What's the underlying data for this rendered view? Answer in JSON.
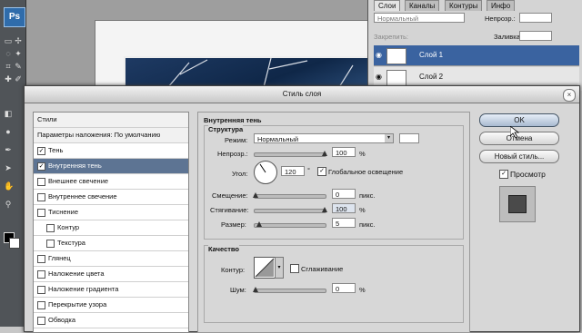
{
  "background": {
    "panel_tabs": [
      "Слои",
      "Каналы",
      "Контуры",
      "Инфо"
    ],
    "blend_mode": "Нормальный",
    "opacity_label": "Непрозр.:",
    "lock_label": "Закрепить:",
    "fill_label": "Заливка:",
    "layers": [
      {
        "name": "Слой 1"
      },
      {
        "name": "Слой 2"
      }
    ]
  },
  "dialog": {
    "title": "Стиль слоя",
    "styles_list": [
      {
        "label": "Стили",
        "checkbox": false,
        "checked": false,
        "header": true
      },
      {
        "label": "Параметры наложения: По умолчанию",
        "checkbox": false,
        "checked": false,
        "header": true
      },
      {
        "label": "Тень",
        "checkbox": true,
        "checked": true
      },
      {
        "label": "Внутренняя тень",
        "checkbox": true,
        "checked": true,
        "selected": true
      },
      {
        "label": "Внешнее свечение",
        "checkbox": true,
        "checked": false
      },
      {
        "label": "Внутреннее свечение",
        "checkbox": true,
        "checked": false
      },
      {
        "label": "Тиснение",
        "checkbox": true,
        "checked": false
      },
      {
        "label": "Контур",
        "checkbox": true,
        "checked": false,
        "indent": true
      },
      {
        "label": "Текстура",
        "checkbox": true,
        "checked": false,
        "indent": true
      },
      {
        "label": "Глянец",
        "checkbox": true,
        "checked": false
      },
      {
        "label": "Наложение цвета",
        "checkbox": true,
        "checked": false
      },
      {
        "label": "Наложение градиента",
        "checkbox": true,
        "checked": false
      },
      {
        "label": "Перекрытие узора",
        "checkbox": true,
        "checked": false
      },
      {
        "label": "Обводка",
        "checkbox": true,
        "checked": false
      }
    ],
    "inner_shadow": {
      "title": "Внутренняя тень",
      "structure": {
        "title": "Структура",
        "mode_label": "Режим:",
        "mode_value": "Нормальный",
        "opacity_label": "Непрозр.:",
        "opacity_value": "100",
        "opacity_unit": "%",
        "angle_label": "Угол:",
        "angle_value": "120",
        "angle_unit": "°",
        "global_light_label": "Глобальное освещение",
        "distance_label": "Смещение:",
        "distance_value": "0",
        "distance_unit": "пикс.",
        "choke_label": "Стягивание:",
        "choke_value": "100",
        "choke_unit": "%",
        "size_label": "Размер:",
        "size_value": "5",
        "size_unit": "пикс."
      },
      "quality": {
        "title": "Качество",
        "contour_label": "Контур:",
        "antialias_label": "Сглаживание",
        "noise_label": "Шум:",
        "noise_value": "0",
        "noise_unit": "%"
      }
    },
    "buttons": {
      "ok": "OK",
      "cancel": "Отмена",
      "new_style": "Новый стиль...",
      "preview": "Просмотр"
    },
    "colors": {
      "selected_row": "#5d7493",
      "shadow_swatch": "#ffffff"
    }
  }
}
